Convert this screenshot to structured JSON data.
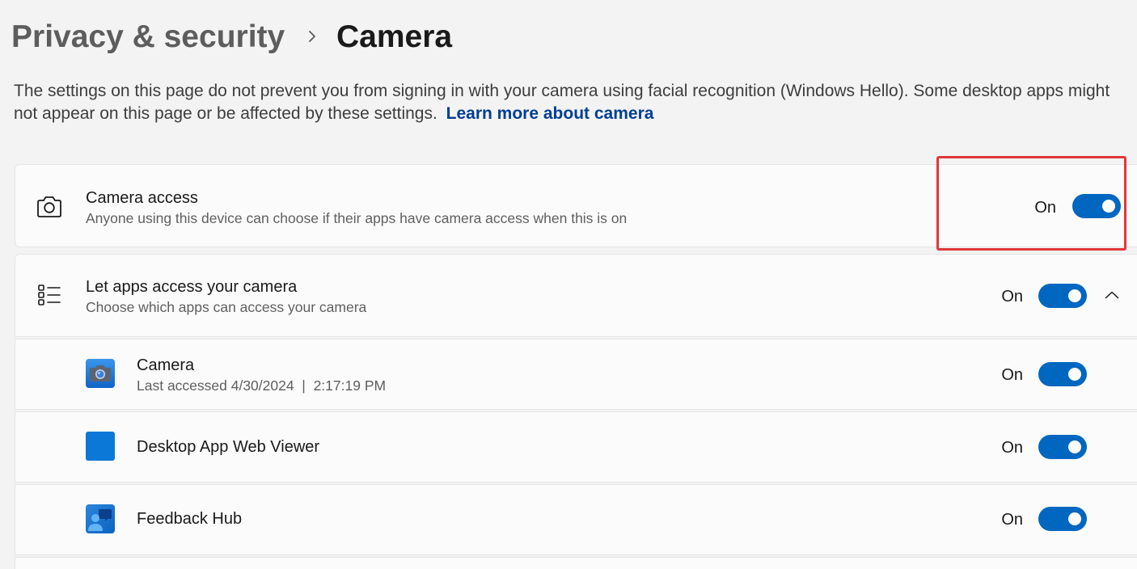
{
  "breadcrumb": {
    "parent": "Privacy & security",
    "current": "Camera",
    "separator_icon": "chevron-right-icon"
  },
  "intro": {
    "text": "The settings on this page do not prevent you from signing in with your camera using facial recognition (Windows Hello). Some desktop apps might not appear on this page or be affected by these settings.",
    "link_label": "Learn more about camera"
  },
  "camera_access": {
    "icon": "camera-icon",
    "title": "Camera access",
    "description": "Anyone using this device can choose if their apps have camera access when this is on",
    "state_label": "On",
    "enabled": true,
    "highlighted": true
  },
  "app_access": {
    "icon": "list-icon",
    "title": "Let apps access your camera",
    "description": "Choose which apps can access your camera",
    "state_label": "On",
    "enabled": true,
    "expanded": true,
    "expand_icon": "chevron-up-icon"
  },
  "apps": [
    {
      "icon": "camera-app-icon",
      "name": "Camera",
      "detail": "Last accessed 4/30/2024  |  2:17:19 PM",
      "state_label": "On",
      "enabled": true
    },
    {
      "icon": "desktop-app-web-viewer-icon",
      "name": "Desktop App Web Viewer",
      "state_label": "On",
      "enabled": true
    },
    {
      "icon": "feedback-hub-icon",
      "name": "Feedback Hub",
      "state_label": "On",
      "enabled": true
    }
  ],
  "colors": {
    "accent": "#0067c0",
    "link": "#003e92",
    "highlight": "#e0373b",
    "page_background": "#f3f3f3",
    "card_background": "#fbfbfb"
  }
}
